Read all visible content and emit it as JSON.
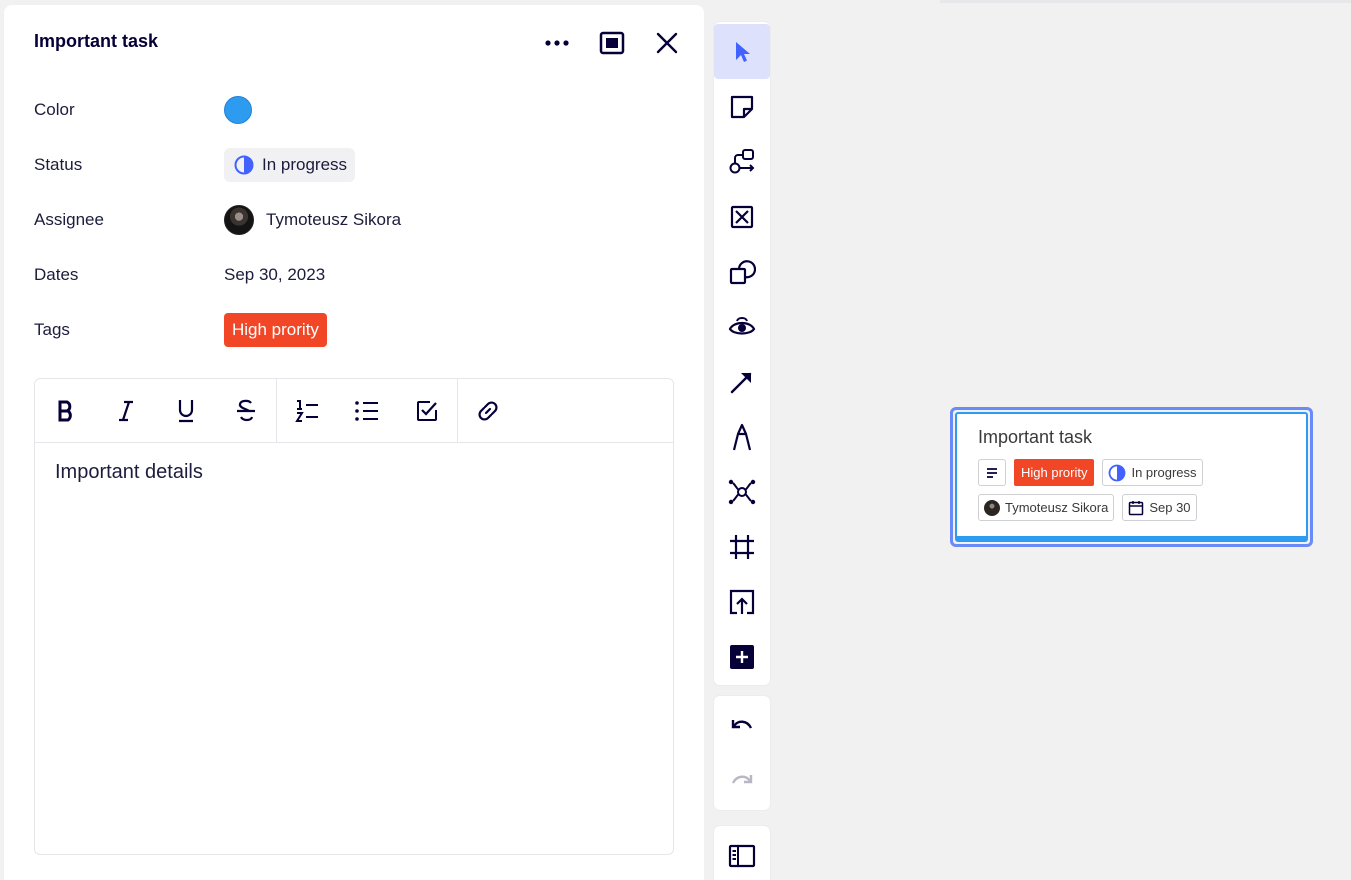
{
  "panel": {
    "title": "Important task",
    "header_icons": [
      "more-icon",
      "fullscreen-icon",
      "close-icon"
    ],
    "properties": {
      "color": {
        "label": "Color",
        "value": "#2d9bf0"
      },
      "status": {
        "label": "Status",
        "value": "In progress",
        "icon": "half-circle-icon"
      },
      "assignee": {
        "label": "Assignee",
        "value": "Tymoteusz Sikora"
      },
      "dates": {
        "label": "Dates",
        "value": "Sep 30, 2023"
      },
      "tags": {
        "label": "Tags",
        "value": "High prority",
        "color": "#f24726"
      }
    },
    "editor": {
      "toolbar_icons": [
        "bold-icon",
        "italic-icon",
        "underline-icon",
        "strikethrough-icon",
        "numbered-list-icon",
        "bullet-list-icon",
        "checklist-icon",
        "link-icon"
      ],
      "content": "Important details"
    }
  },
  "vertical_toolbar": {
    "tools": [
      "select-icon",
      "sticky-note-icon",
      "flowchart-icon",
      "frame-placeholder-icon",
      "shapes-icon",
      "visibility-icon",
      "arrow-line-icon",
      "pen-icon",
      "mindmap-icon",
      "crop-frame-icon",
      "upload-icon",
      "add-icon"
    ],
    "history": [
      "undo-icon",
      "redo-icon"
    ],
    "bottom": [
      "panel-toggle-icon"
    ]
  },
  "canvas_card": {
    "title": "Important task",
    "tag": "High prority",
    "status": "In progress",
    "assignee": "Tymoteusz Sikora",
    "date": "Sep 30",
    "accent": "#2d9bf0",
    "selection_color": "#6a8af7"
  }
}
